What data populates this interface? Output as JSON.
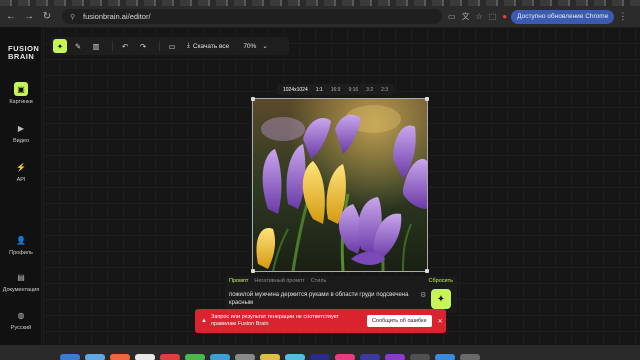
{
  "browser": {
    "url": "fusionbrain.ai/editor/",
    "update_label": "Доступно обновление Chrome"
  },
  "sidebar": {
    "logo": "FUSION BRAIN",
    "items": [
      {
        "label": "Картинки",
        "icon": "image-icon",
        "active": true
      },
      {
        "label": "Видео",
        "icon": "video-icon",
        "active": false
      },
      {
        "label": "API",
        "icon": "api-icon",
        "active": false
      },
      {
        "label": "Профиль",
        "icon": "profile-icon",
        "active": false
      },
      {
        "label": "Документация",
        "icon": "document-icon",
        "active": false
      },
      {
        "label": "Русский",
        "icon": "globe-icon",
        "active": false
      }
    ]
  },
  "editor_toolbar": {
    "download_label": "Скачать все",
    "zoom_label": "70%"
  },
  "ratios": [
    "1024x1024",
    "1:1",
    "16:9",
    "9:16",
    "3:2",
    "2:3"
  ],
  "prompt": {
    "tabs": [
      "Промпт",
      "Негативный промпт",
      "Стиль"
    ],
    "reset_label": "Сбросить",
    "text": "пожилой мужчина держится руками в  области груди подсвечена красным"
  },
  "toast": {
    "message": "Запрос или результат генерации не соответствует правилам Fusion Brain",
    "button_label": "Сообщить об ошибке"
  },
  "colors": {
    "accent": "#c6f45a",
    "error": "#d9242f"
  }
}
